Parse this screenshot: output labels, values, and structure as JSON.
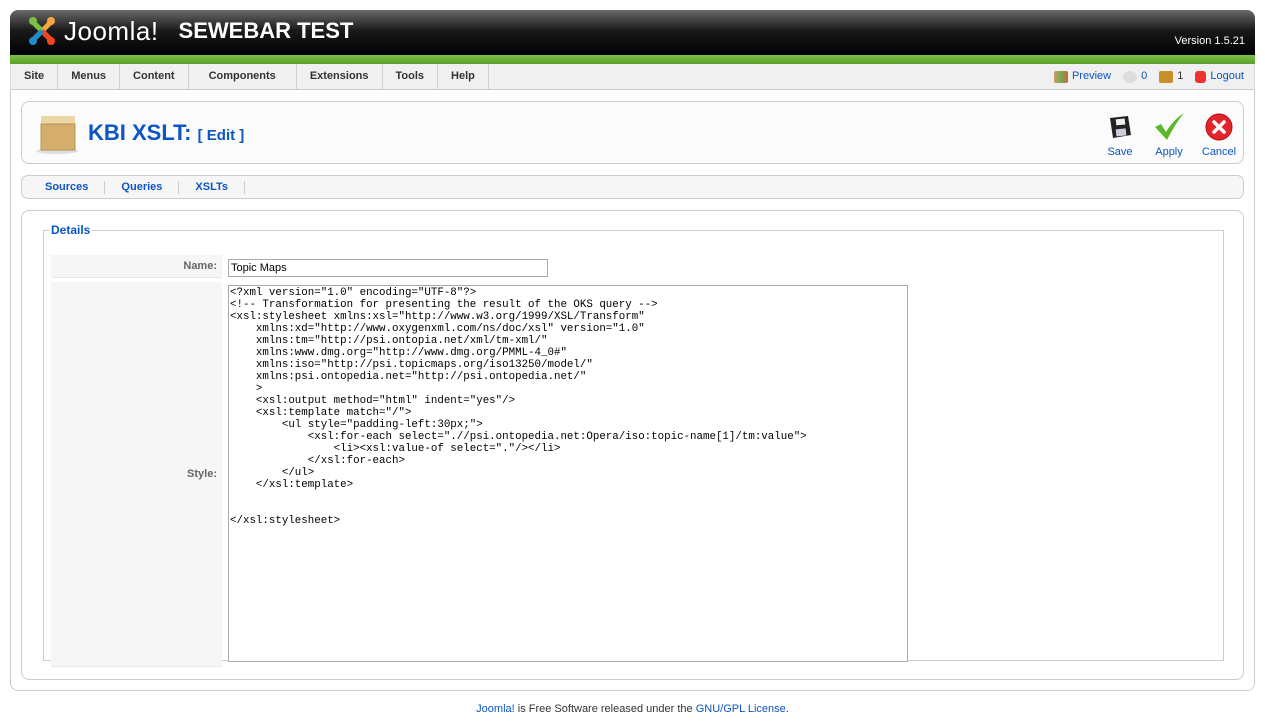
{
  "header": {
    "brand": "Joomla!",
    "site_name": "SEWEBAR TEST",
    "version": "Version 1.5.21"
  },
  "menu": [
    "Site",
    "Menus",
    "Content",
    "Components",
    "Extensions",
    "Tools",
    "Help"
  ],
  "status": {
    "preview": "Preview",
    "messages": "0",
    "users": "1",
    "logout": "Logout"
  },
  "toolbar": {
    "title": "KBI XSLT:",
    "subtitle": "[ Edit ]",
    "save": "Save",
    "apply": "Apply",
    "cancel": "Cancel"
  },
  "submenu": [
    "Sources",
    "Queries",
    "XSLTs"
  ],
  "form": {
    "legend": "Details",
    "name_label": "Name:",
    "name_value": "Topic Maps",
    "style_label": "Style:",
    "style_value": "<?xml version=\"1.0\" encoding=\"UTF-8\"?>\n<!-- Transformation for presenting the result of the OKS query -->\n<xsl:stylesheet xmlns:xsl=\"http://www.w3.org/1999/XSL/Transform\"\n    xmlns:xd=\"http://www.oxygenxml.com/ns/doc/xsl\" version=\"1.0\"\n    xmlns:tm=\"http://psi.ontopia.net/xml/tm-xml/\"\n    xmlns:www.dmg.org=\"http://www.dmg.org/PMML-4_0#\"\n    xmlns:iso=\"http://psi.topicmaps.org/iso13250/model/\"\n    xmlns:psi.ontopedia.net=\"http://psi.ontopedia.net/\"\n    >\n    <xsl:output method=\"html\" indent=\"yes\"/>\n    <xsl:template match=\"/\">\n        <ul style=\"padding-left:30px;\">\n            <xsl:for-each select=\".//psi.ontopedia.net:Opera/iso:topic-name[1]/tm:value\">\n                <li><xsl:value-of select=\".\"/></li>\n            </xsl:for-each>\n        </ul>\n    </xsl:template>\n\n\n</xsl:stylesheet>"
  },
  "footer": {
    "joomla_link": "Joomla!",
    "text": " is Free Software released under the ",
    "license_link": "GNU/GPL License",
    "end": "."
  },
  "colors": {
    "link": "#0b55c4",
    "green_bar": "#6cb33a"
  }
}
